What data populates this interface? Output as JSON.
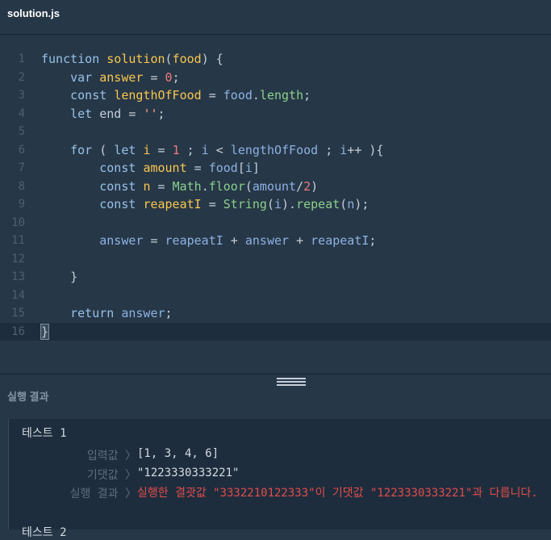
{
  "file_tab": {
    "name": "solution.js"
  },
  "editor": {
    "lines": [
      "1",
      "2",
      "3",
      "4",
      "5",
      "6",
      "7",
      "8",
      "9",
      "10",
      "11",
      "12",
      "13",
      "14",
      "15",
      "16"
    ]
  },
  "results": {
    "title": "실행 결과",
    "test": {
      "title": "테스트 1",
      "input_label": "입력값 〉",
      "input_value": "[1, 3, 4, 6]",
      "expected_label": "기댓값 〉",
      "expected_value": "\"1223330333221\"",
      "result_label": "실행 결과 〉",
      "result_value": "실행한 결괏값 \"3332210122333\"이 기댓값 \"1223330333221\"과 다릅니다."
    },
    "next_test_title": "테스트 2"
  },
  "colors": {
    "background": "#263747",
    "panel": "#1e2d3d",
    "error": "#e34c4c"
  }
}
